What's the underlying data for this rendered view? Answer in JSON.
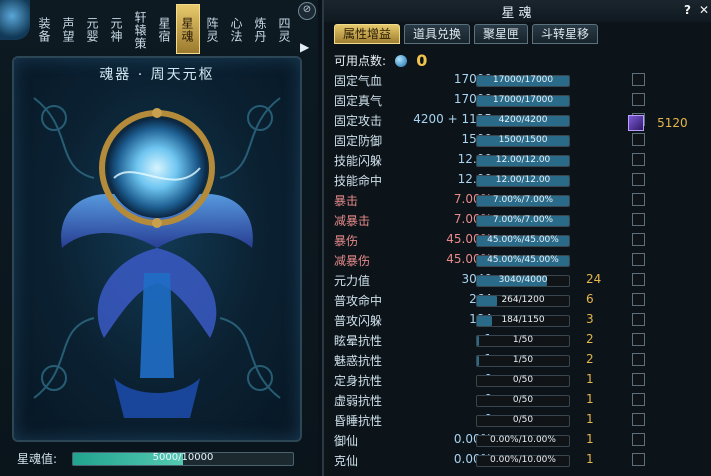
{
  "left": {
    "vertical_tabs": [
      "装备",
      "声望",
      "元婴",
      "元神",
      "轩辕策",
      "星宿",
      "星魂",
      "阵灵",
      "心法",
      "炼丹",
      "四灵"
    ],
    "active_tab_index": 6,
    "art_title": "魂器 · 周天元枢",
    "soul_label": "星魂值:",
    "soul_value": "5000/10000",
    "soul_fraction": 0.5
  },
  "right": {
    "title": "星魂",
    "help": "?",
    "close": "✕",
    "tabs": [
      "属性增益",
      "道具兑换",
      "聚星匣",
      "斗转星移"
    ],
    "active_tab_index": 0,
    "points_label": "可用点数:",
    "points_value": "0",
    "bonus_value": "5120",
    "stats": [
      {
        "label": "固定气血",
        "value": "17000",
        "bar": "17000/17000",
        "fill": 1.0,
        "points": "",
        "color": "normal"
      },
      {
        "label": "固定真气",
        "value": "17000",
        "bar": "17000/17000",
        "fill": 1.0,
        "points": "",
        "color": "normal"
      },
      {
        "label": "固定攻击",
        "value": "4200 + 1125",
        "bar": "4200/4200",
        "fill": 1.0,
        "points": "",
        "color": "normal"
      },
      {
        "label": "固定防御",
        "value": "1500",
        "bar": "1500/1500",
        "fill": 1.0,
        "points": "",
        "color": "normal"
      },
      {
        "label": "技能闪躲",
        "value": "12.00",
        "bar": "12.00/12.00",
        "fill": 1.0,
        "points": "",
        "color": "normal"
      },
      {
        "label": "技能命中",
        "value": "12.00",
        "bar": "12.00/12.00",
        "fill": 1.0,
        "points": "",
        "color": "normal"
      },
      {
        "label": "暴击",
        "value": "7.00%",
        "bar": "7.00%/7.00%",
        "fill": 1.0,
        "points": "",
        "color": "red"
      },
      {
        "label": "减暴击",
        "value": "7.00%",
        "bar": "7.00%/7.00%",
        "fill": 1.0,
        "points": "",
        "color": "red"
      },
      {
        "label": "暴伤",
        "value": "45.00%",
        "bar": "45.00%/45.00%",
        "fill": 1.0,
        "points": "",
        "color": "red"
      },
      {
        "label": "减暴伤",
        "value": "45.00%",
        "bar": "45.00%/45.00%",
        "fill": 1.0,
        "points": "",
        "color": "red"
      },
      {
        "label": "元力值",
        "value": "3040",
        "bar": "3040/4000",
        "fill": 0.76,
        "points": "24",
        "color": "normal"
      },
      {
        "label": "普攻命中",
        "value": "264",
        "bar": "264/1200",
        "fill": 0.22,
        "points": "6",
        "color": "normal"
      },
      {
        "label": "普攻闪躲",
        "value": "184",
        "bar": "184/1150",
        "fill": 0.16,
        "points": "3",
        "color": "normal"
      },
      {
        "label": "眩晕抗性",
        "value": "1",
        "bar": "1/50",
        "fill": 0.02,
        "points": "2",
        "color": "normal"
      },
      {
        "label": "魅惑抗性",
        "value": "1",
        "bar": "1/50",
        "fill": 0.02,
        "points": "2",
        "color": "normal"
      },
      {
        "label": "定身抗性",
        "value": "0",
        "bar": "0/50",
        "fill": 0.0,
        "points": "1",
        "color": "normal"
      },
      {
        "label": "虚弱抗性",
        "value": "0",
        "bar": "0/50",
        "fill": 0.0,
        "points": "1",
        "color": "normal"
      },
      {
        "label": "昏睡抗性",
        "value": "0",
        "bar": "0/50",
        "fill": 0.0,
        "points": "1",
        "color": "normal"
      },
      {
        "label": "御仙",
        "value": "0.00%",
        "bar": "0.00%/10.00%",
        "fill": 0.0,
        "points": "1",
        "color": "normal"
      },
      {
        "label": "克仙",
        "value": "0.00%",
        "bar": "0.00%/10.00%",
        "fill": 0.0,
        "points": "1",
        "color": "normal"
      }
    ]
  },
  "colors": {
    "gold": "#e6b54b",
    "accent_tab": "#e5c86b",
    "bar_fill": "#2a6b8a"
  }
}
